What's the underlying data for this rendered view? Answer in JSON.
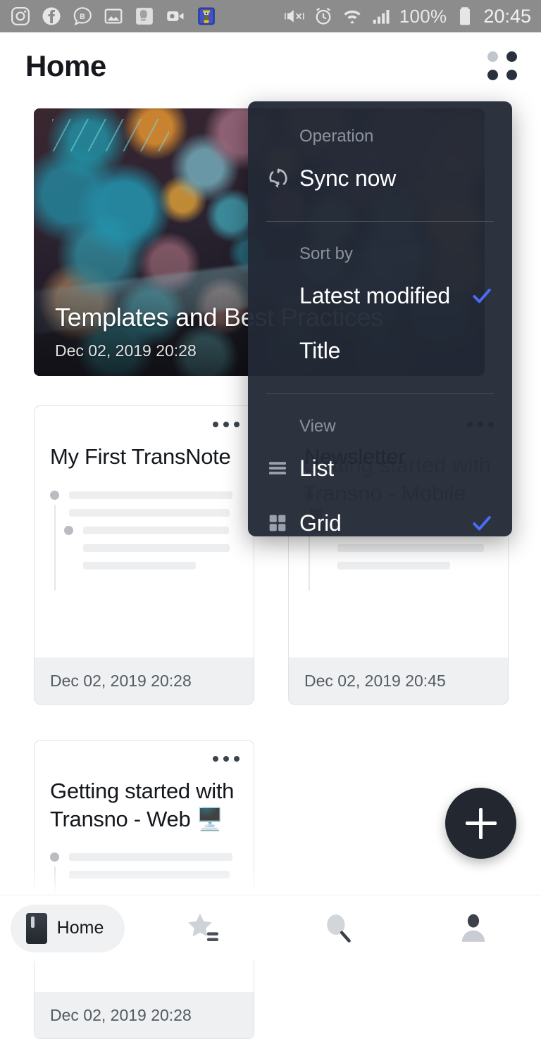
{
  "statusbar": {
    "notification_icons": [
      "instagram-icon",
      "facebook-icon",
      "chat-b-icon",
      "photo-icon",
      "boxing-glove-icon",
      "video-camera-icon",
      "card-game-icon"
    ],
    "system_icons": [
      "mute-vibrate-icon",
      "alarm-icon",
      "wifi-icon",
      "signal-icon",
      "battery-icon"
    ],
    "battery_percent": "100%",
    "time": "20:45"
  },
  "header": {
    "title": "Home",
    "grid_toggle_icon": "grid-dots-icon"
  },
  "hero": {
    "title": "Templates and Best Practices",
    "date": "Dec 02, 2019 20:28"
  },
  "cards": [
    {
      "title": "My First TransNote",
      "date": "Dec 02, 2019 20:28",
      "menu_icon": "more-horizontal-icon"
    },
    {
      "title": "Newsletter",
      "date": "Dec 02, 2019 20:45",
      "menu_icon": "more-horizontal-icon"
    },
    {
      "title": "Getting started with Transno - Web 🖥️",
      "date": "Dec 02, 2019 20:28",
      "menu_icon": "more-horizontal-icon"
    }
  ],
  "obscured_card": {
    "title": "Getting started with Transno - Mobile 📱"
  },
  "menu": {
    "sections": [
      {
        "label": "Operation",
        "items": [
          {
            "label": "Sync now",
            "icon": "sync-icon",
            "checked": false
          }
        ]
      },
      {
        "label": "Sort by",
        "items": [
          {
            "label": "Latest modified",
            "icon": "",
            "checked": true
          },
          {
            "label": "Title",
            "icon": "",
            "checked": false
          }
        ]
      },
      {
        "label": "View",
        "items": [
          {
            "label": "List",
            "icon": "list-icon",
            "checked": false
          },
          {
            "label": "Grid",
            "icon": "grid-icon",
            "checked": true
          }
        ]
      }
    ],
    "accent_color": "#4a6cf7",
    "background_color": "#232935"
  },
  "fab": {
    "icon": "plus-icon",
    "background_color": "#23272f"
  },
  "bottomnav": {
    "items": [
      {
        "label": "Home",
        "icon": "book-icon",
        "active": true
      },
      {
        "label": "",
        "icon": "star-list-icon",
        "active": false
      },
      {
        "label": "",
        "icon": "search-icon",
        "active": false
      },
      {
        "label": "",
        "icon": "profile-icon",
        "active": false
      }
    ]
  }
}
